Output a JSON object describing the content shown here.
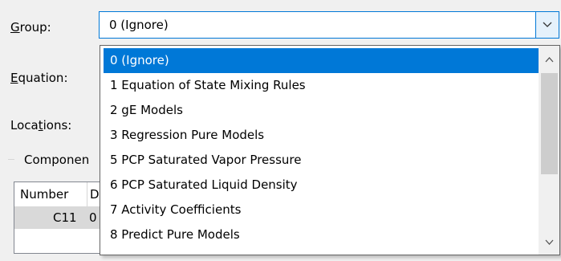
{
  "form": {
    "group_label": "Group:",
    "group_mnemonic": "G",
    "group_rest": "roup:",
    "equation_mnemonic": "E",
    "equation_rest": "quation:",
    "locations_pre": "Loca",
    "locations_mnemonic": "t",
    "locations_rest": "ions:"
  },
  "combo": {
    "value": "0 (Ignore)",
    "icon": "chevron-down-icon"
  },
  "dropdown": {
    "selected_index": 0,
    "items": [
      "0 (Ignore)",
      "1 Equation of State Mixing Rules",
      "2 gE Models",
      "3 Regression Pure Models",
      "5 PCP Saturated Vapor Pressure",
      "6 PCP Saturated Liquid Density",
      "7 Activity Coefficients",
      "8 Predict Pure Models"
    ],
    "scroll_position": 0.0
  },
  "background": {
    "group_title": "Componen",
    "table": {
      "columns": [
        "Number",
        "D"
      ],
      "row": {
        "number": "C11",
        "d": "0"
      }
    }
  },
  "colors": {
    "selection": "#0078d7",
    "combo_border": "#0078d7",
    "combo_button": "#e5f1fb",
    "window_bg": "#f0f0f0"
  }
}
